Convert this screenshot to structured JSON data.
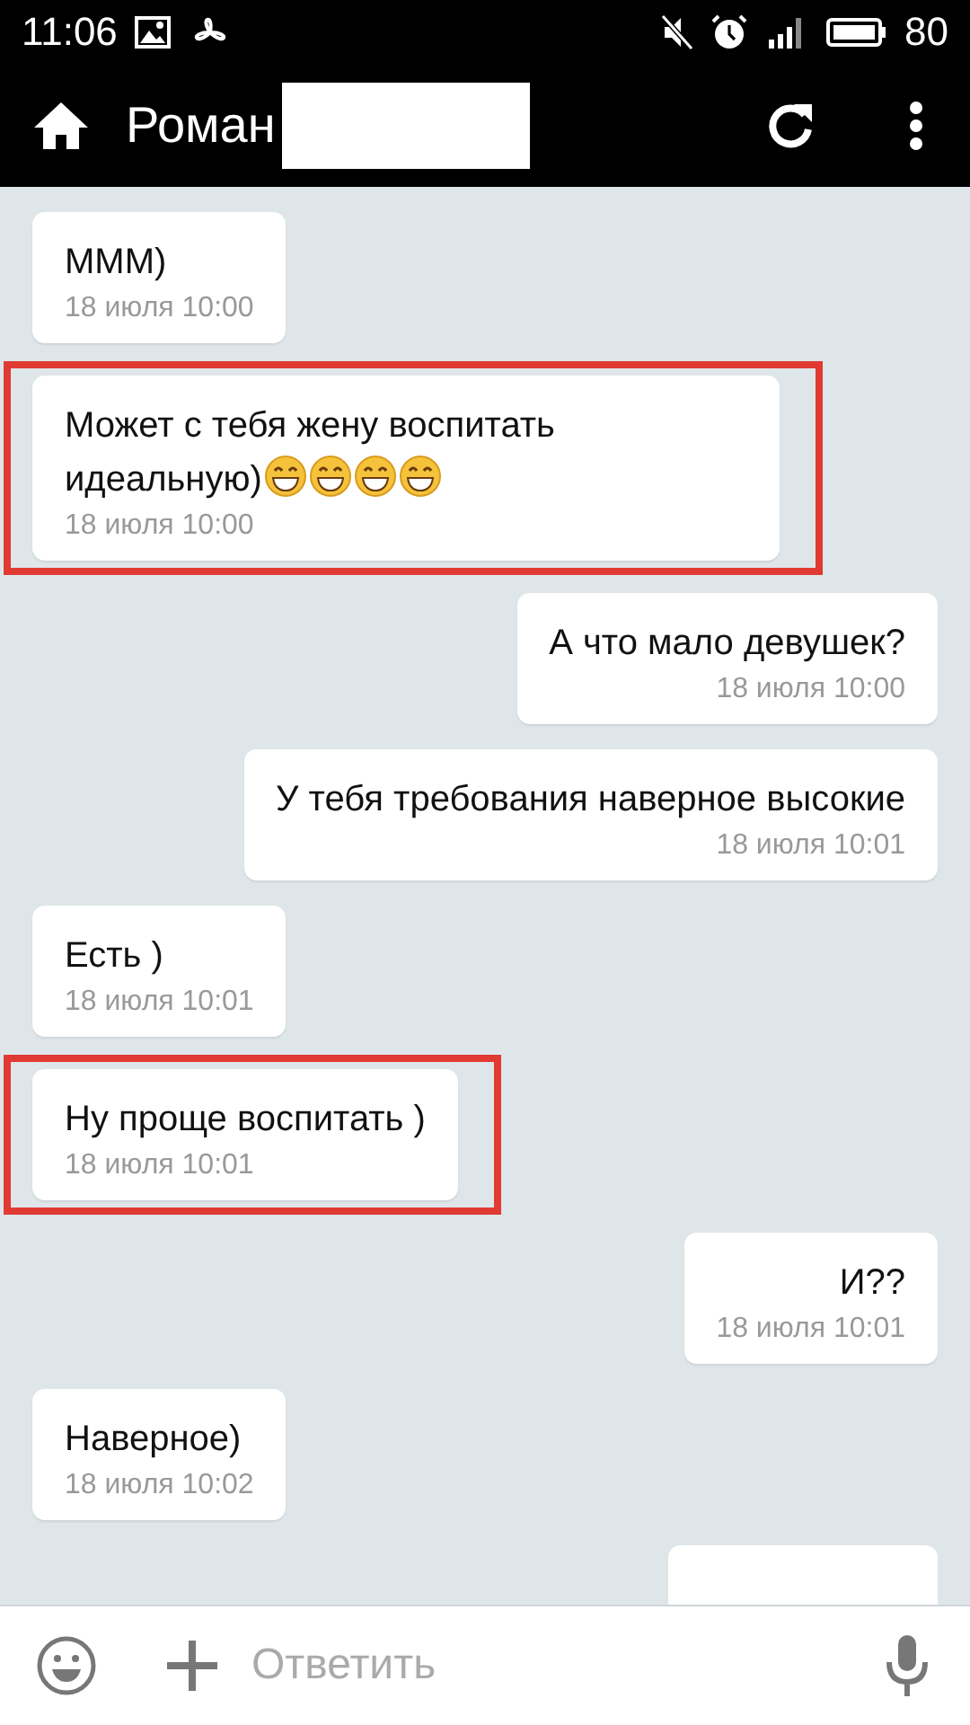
{
  "status_bar": {
    "time": "11:06",
    "battery": "80"
  },
  "app_bar": {
    "title": "Роман",
    "name_redacted": true
  },
  "messages": [
    {
      "kind": "incoming",
      "text": "МММ)",
      "time": "18 июля 10:00",
      "highlighted": false
    },
    {
      "kind": "incoming",
      "text": "Может с тебя жену воспитать идеальную)",
      "emojis": [
        {
          "kind": "grin"
        },
        {
          "kind": "grin"
        },
        {
          "kind": "grin"
        },
        {
          "kind": "grin"
        }
      ],
      "time": "18 июля 10:00",
      "highlighted": true
    },
    {
      "kind": "outgoing",
      "text": "А что мало девушек?",
      "time": "18 июля 10:00",
      "highlighted": false
    },
    {
      "kind": "outgoing",
      "text": "У тебя требования наверное высокие",
      "time": "18 июля 10:01",
      "highlighted": false
    },
    {
      "kind": "incoming",
      "text": "Есть )",
      "time": "18 июля 10:01",
      "highlighted": false
    },
    {
      "kind": "incoming",
      "text": "Ну проще воспитать )",
      "time": "18 июля 10:01",
      "highlighted": true
    },
    {
      "kind": "outgoing",
      "text": "И??",
      "time": "18 июля 10:01",
      "highlighted": false
    },
    {
      "kind": "incoming",
      "text": "Наверное)",
      "time": "18 июля 10:02",
      "highlighted": false
    }
  ],
  "composer": {
    "placeholder": "Ответить"
  }
}
